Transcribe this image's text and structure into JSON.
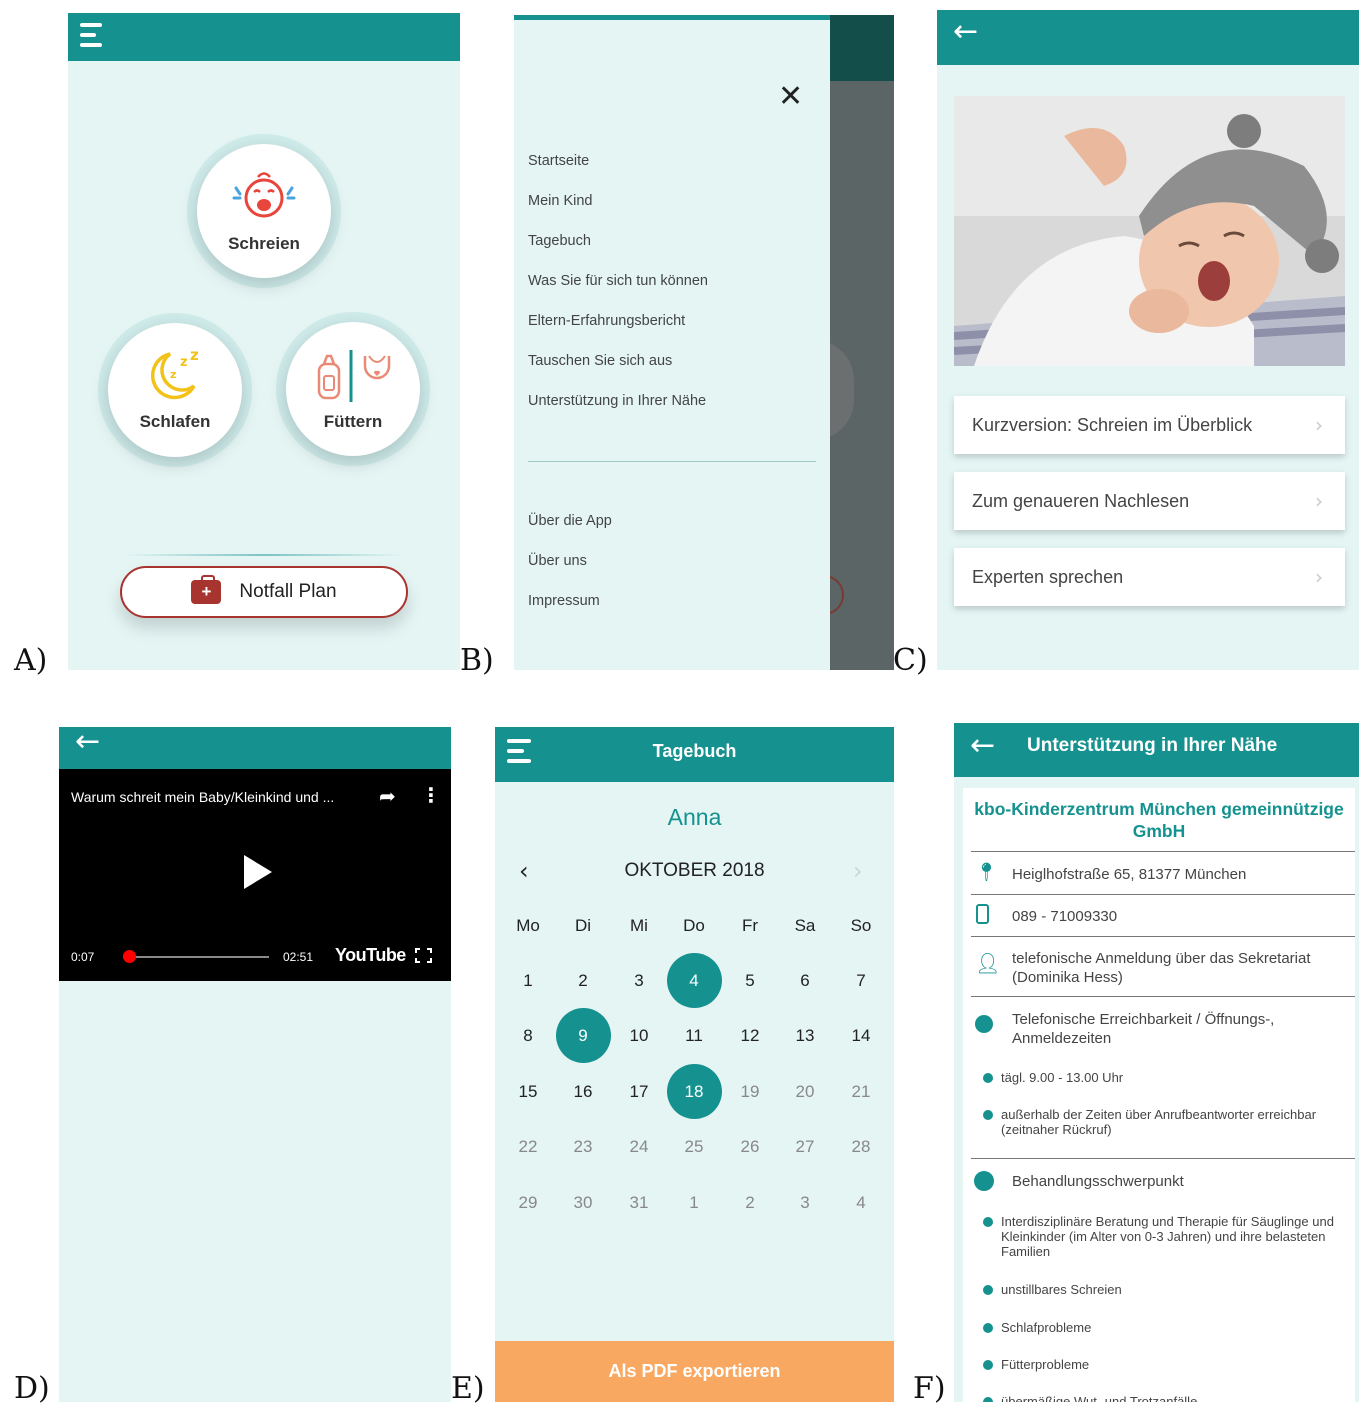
{
  "labels": [
    "A)",
    "B)",
    "C)",
    "D)",
    "E)",
    "F)"
  ],
  "colors": {
    "teal": "#15928f",
    "mint_bg": "#e4f5f4",
    "red": "#a8342f",
    "orange": "#f8a861"
  },
  "screenA": {
    "menu_icon": "hamburger-icon",
    "buttons": {
      "crying": "Schreien",
      "sleeping": "Schlafen",
      "feeding": "Füttern"
    },
    "emergency": "Notfall Plan"
  },
  "screenB": {
    "close_icon": "close-icon",
    "menu": [
      "Startseite",
      "Mein Kind",
      "Tagebuch",
      "Was Sie für sich tun können",
      "Eltern-Erfahrungsbericht",
      "Tauschen Sie sich aus",
      "Unterstützung in Ihrer Nähe"
    ],
    "footer_menu": [
      "Über die App",
      "Über uns",
      "Impressum"
    ]
  },
  "screenC": {
    "rows": [
      "Kurzversion: Schreien im Überblick",
      "Zum genaueren Nachlesen",
      "Experten sprechen"
    ]
  },
  "screenD": {
    "video_title": "Warum schreit mein Baby/Kleinkind und ...",
    "current_time": "0:07",
    "duration": "02:51",
    "progress": 0.041,
    "brand": "YouTube"
  },
  "screenE": {
    "title": "Tagebuch",
    "child": "Anna",
    "month": "OKTOBER 2018",
    "weekdays": [
      "Mo",
      "Di",
      "Mi",
      "Do",
      "Fr",
      "Sa",
      "So"
    ],
    "days": [
      [
        "1",
        "2",
        "3",
        "4",
        "5",
        "6",
        "7"
      ],
      [
        "8",
        "9",
        "10",
        "11",
        "12",
        "13",
        "14"
      ],
      [
        "15",
        "16",
        "17",
        "18",
        "19",
        "20",
        "21"
      ],
      [
        "22",
        "23",
        "24",
        "25",
        "26",
        "27",
        "28"
      ],
      [
        "29",
        "30",
        "31",
        "1",
        "2",
        "3",
        "4"
      ]
    ],
    "selected_days": [
      4,
      9,
      18
    ],
    "export": "Als PDF exportieren"
  },
  "screenF": {
    "title": "Unterstützung in Ihrer Nähe",
    "org": "kbo-Kinderzentrum München gemeinnützige GmbH",
    "address": "Heiglhofstraße 65, 81377 München",
    "phone": "089 - 71009330",
    "registration": "telefonische Anmeldung über das Sekretariat (Dominika Hess)",
    "hours_title": "Telefonische Erreichbarkeit / Öffnungs-, Anmeldezeiten",
    "hours": [
      "tägl. 9.00 - 13.00 Uhr",
      "außerhalb der Zeiten über Anrufbeantworter erreichbar (zeitnaher Rückruf)"
    ],
    "focus_title": "Behandlungsschwerpunkt",
    "focus": [
      "Interdisziplinäre Beratung und Therapie für Säuglinge und Kleinkinder (im Alter von 0-3 Jahren) und ihre belasteten Familien",
      "unstillbares Schreien",
      "Schlafprobleme",
      "Fütterprobleme",
      "übermäßige Wut- und Trotzanfälle"
    ]
  }
}
